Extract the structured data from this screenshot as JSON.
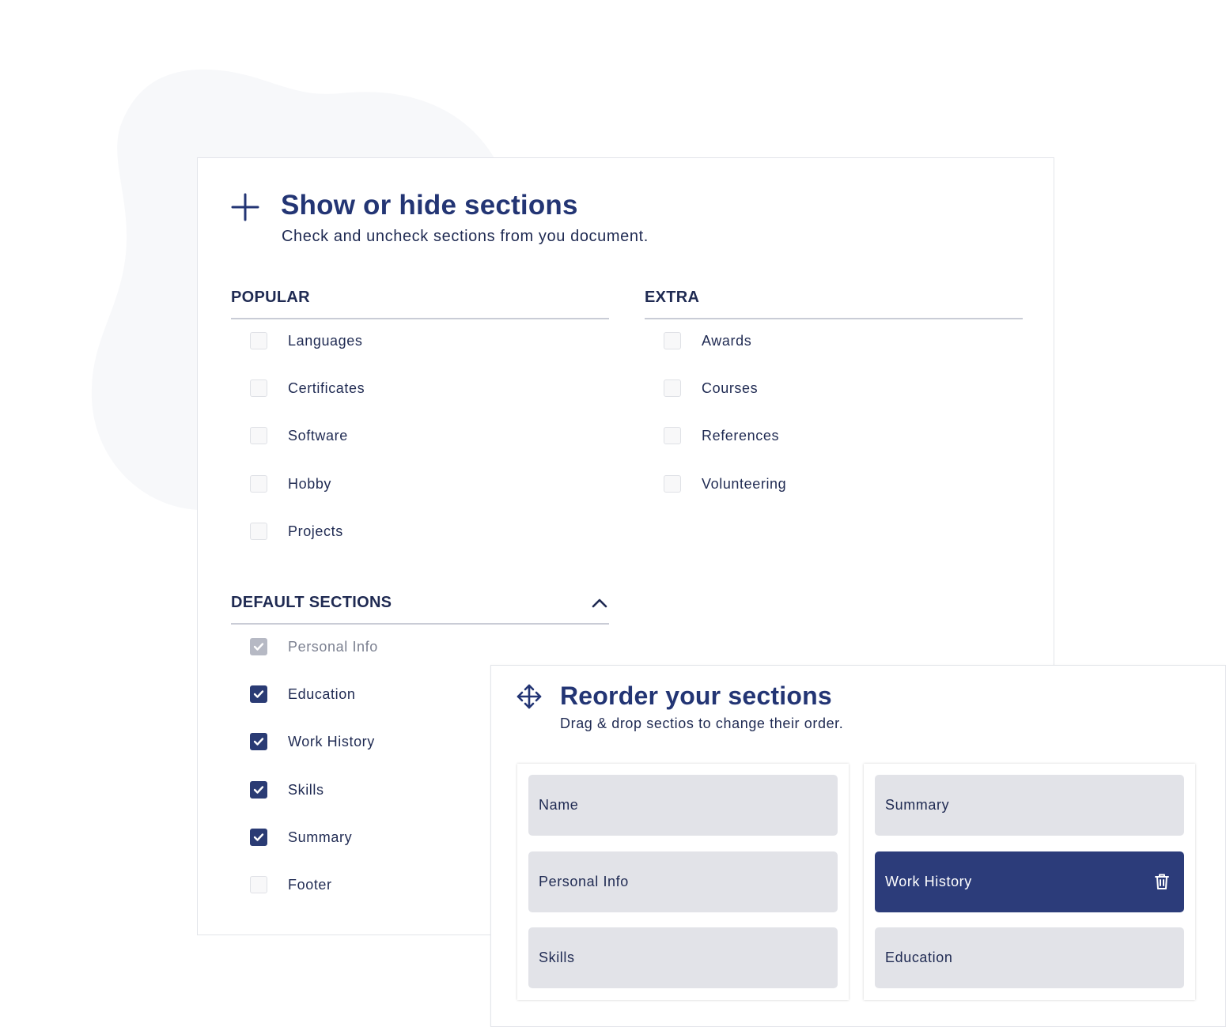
{
  "colors": {
    "primary": "#233574",
    "checkbox_checked": "#2a3b74",
    "checkbox_disabled": "#b6b9c4",
    "tile_bg": "#e2e3e8",
    "tile_active": "#2c3c7a",
    "blob": "#f7f8fa"
  },
  "show_hide": {
    "icon": "plus-icon",
    "title": "Show or hide sections",
    "subtitle": "Check and uncheck sections from you document.",
    "popular": {
      "heading": "POPULAR",
      "items": [
        {
          "label": "Languages",
          "state": "unchecked"
        },
        {
          "label": "Certificates",
          "state": "unchecked"
        },
        {
          "label": "Software",
          "state": "unchecked"
        },
        {
          "label": "Hobby",
          "state": "unchecked"
        },
        {
          "label": "Projects",
          "state": "unchecked"
        }
      ]
    },
    "extra": {
      "heading": "EXTRA",
      "items": [
        {
          "label": "Awards",
          "state": "unchecked"
        },
        {
          "label": "Courses",
          "state": "unchecked"
        },
        {
          "label": "References",
          "state": "unchecked"
        },
        {
          "label": "Volunteering",
          "state": "unchecked"
        }
      ]
    },
    "default_sections": {
      "heading": "DEFAULT SECTIONS",
      "toggle_icon": "chevron-up-icon",
      "items": [
        {
          "label": "Personal Info",
          "state": "disabled-checked"
        },
        {
          "label": "Education",
          "state": "checked"
        },
        {
          "label": "Work History",
          "state": "checked"
        },
        {
          "label": "Skills",
          "state": "checked"
        },
        {
          "label": "Summary",
          "state": "checked"
        },
        {
          "label": "Footer",
          "state": "unchecked"
        }
      ]
    }
  },
  "reorder": {
    "icon": "move-icon",
    "title": "Reorder your sections",
    "subtitle": "Drag & drop sectios to change their order.",
    "left_column": [
      {
        "label": "Name"
      },
      {
        "label": "Personal Info"
      },
      {
        "label": "Skills"
      }
    ],
    "right_column": [
      {
        "label": "Summary",
        "active": false
      },
      {
        "label": "Work History",
        "active": true,
        "action_icon": "trash-icon"
      },
      {
        "label": "Education",
        "active": false
      }
    ]
  }
}
